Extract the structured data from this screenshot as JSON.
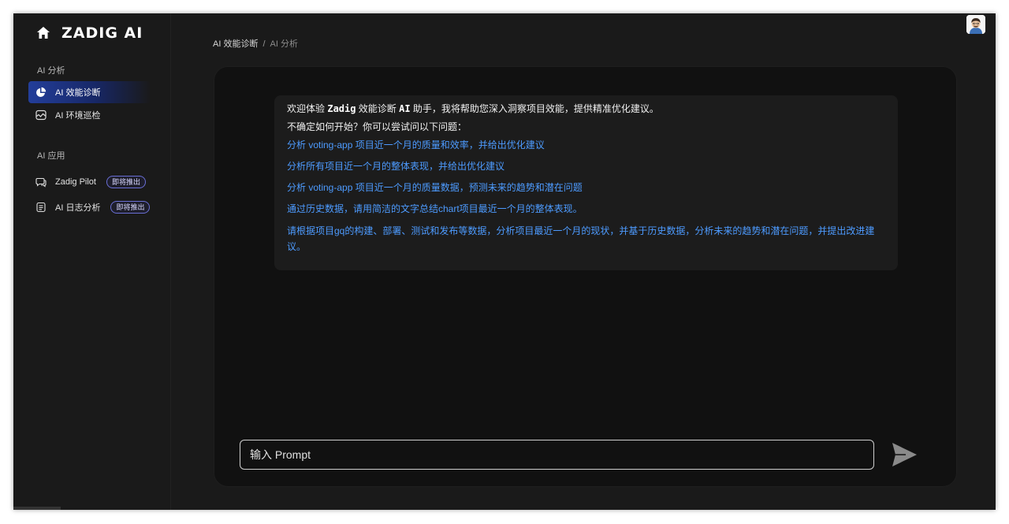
{
  "brand": {
    "logo_text": "ZADIG AI",
    "icon": "home-icon"
  },
  "sidebar": {
    "sections": [
      {
        "title": "AI 分析",
        "items": [
          {
            "label": "AI 效能诊断",
            "icon": "pie-chart-icon",
            "active": true
          },
          {
            "label": "AI 环境巡检",
            "icon": "monitor-wave-icon",
            "active": false
          }
        ]
      },
      {
        "title": "AI 应用",
        "items": [
          {
            "label": "Zadig Pilot",
            "icon": "chat-bubbles-icon",
            "badge": "即将推出"
          },
          {
            "label": "AI 日志分析",
            "icon": "document-icon",
            "badge": "即将推出"
          }
        ]
      }
    ]
  },
  "breadcrumb": {
    "parent": "AI 效能诊断",
    "separator": "/",
    "current": "AI 分析"
  },
  "avatar": {
    "icon": "user-avatar-icon"
  },
  "chat": {
    "welcome_prefix": "欢迎体验 ",
    "welcome_brand": "Zadig",
    "welcome_mid": " 效能诊断 ",
    "welcome_ai": "AI",
    "welcome_suffix": " 助手，我将帮助您深入洞察项目效能，提供精准优化建议。",
    "prompt_intro": "不确定如何开始？你可以尝试问以下问题：",
    "suggestions": [
      "分析 voting-app 项目近一个月的质量和效率，并给出优化建议",
      "分析所有项目近一个月的整体表现，并给出优化建议",
      "分析 voting-app 项目近一个月的质量数据，预测未来的趋势和潜在问题",
      "通过历史数据，请用简洁的文字总结chart项目最近一个月的整体表现。",
      "请根据项目gq的构建、部署、测试和发布等数据，分析项目最近一个月的现状，并基于历史数据，分析未来的趋势和潜在问题，并提出改进建议。"
    ]
  },
  "input": {
    "placeholder": "输入 Prompt",
    "value": ""
  },
  "send": {
    "icon": "send-icon"
  },
  "colors": {
    "accent": "#4d9bff",
    "active_nav": "#233e9a",
    "badge_border": "#6a6fd6"
  }
}
